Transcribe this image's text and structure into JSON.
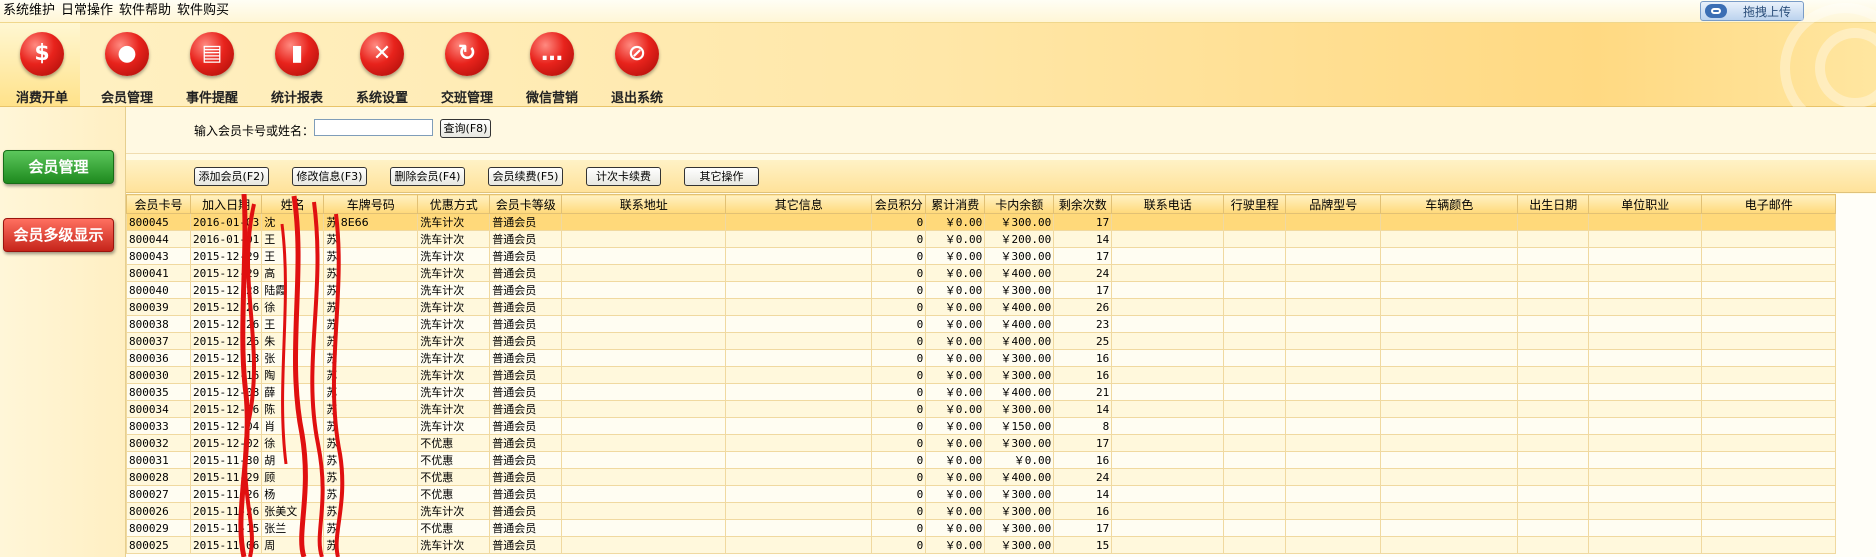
{
  "menu": [
    "系统维护",
    "日常操作",
    "软件帮助",
    "软件购买"
  ],
  "upload_button": "拖拽上传",
  "toolbar": [
    {
      "label": "消费开单",
      "icon": "dollar-icon",
      "glyph": "$"
    },
    {
      "label": "会员管理",
      "icon": "member-icon",
      "glyph": "●"
    },
    {
      "label": "事件提醒",
      "icon": "book-icon",
      "glyph": "▤"
    },
    {
      "label": "统计报表",
      "icon": "bar-chart-icon",
      "glyph": "▮"
    },
    {
      "label": "系统设置",
      "icon": "tools-icon",
      "glyph": "✕"
    },
    {
      "label": "交班管理",
      "icon": "refresh-icon",
      "glyph": "↻"
    },
    {
      "label": "微信营销",
      "icon": "chat-icon",
      "glyph": "…"
    },
    {
      "label": "退出系统",
      "icon": "no-entry-icon",
      "glyph": "⊘"
    }
  ],
  "sidebar": {
    "member_manage": "会员管理",
    "member_level_display": "会员多级显示"
  },
  "search": {
    "label": "输入会员卡号或姓名：",
    "value": "",
    "query_button": "查询(F8)"
  },
  "actions": {
    "add": "添加会员(F2)",
    "edit": "修改信息(F3)",
    "delete": "删除会员(F4)",
    "renew": "会员续费(F5)",
    "count_renew": "计次卡续费",
    "other": "其它操作"
  },
  "table": {
    "columns": [
      "会员卡号",
      "加入日期",
      "姓名",
      "车牌号码",
      "优惠方式",
      "会员卡等级",
      "联系地址",
      "其它信息",
      "会员积分",
      "累计消费",
      "卡内余额",
      "剩余次数",
      "联系电话",
      "行驶里程",
      "品牌型号",
      "车辆颜色",
      "出生日期",
      "单位职业",
      "电子邮件"
    ],
    "rows": [
      [
        "800045",
        "2016-01-03",
        "沈",
        "苏 8E66",
        "洗车计次",
        "普通会员",
        "",
        "",
        "0",
        "￥0.00",
        "￥300.00",
        "17"
      ],
      [
        "800044",
        "2016-01-01",
        "王",
        "苏",
        "洗车计次",
        "普通会员",
        "",
        "",
        "0",
        "￥0.00",
        "￥200.00",
        "14"
      ],
      [
        "800043",
        "2015-12-29",
        "王",
        "苏",
        "洗车计次",
        "普通会员",
        "",
        "",
        "0",
        "￥0.00",
        "￥300.00",
        "17"
      ],
      [
        "800041",
        "2015-12-29",
        "高",
        "苏",
        "洗车计次",
        "普通会员",
        "",
        "",
        "0",
        "￥0.00",
        "￥400.00",
        "24"
      ],
      [
        "800040",
        "2015-12-28",
        "陆霞",
        "苏",
        "洗车计次",
        "普通会员",
        "",
        "",
        "0",
        "￥0.00",
        "￥300.00",
        "17"
      ],
      [
        "800039",
        "2015-12-26",
        "徐",
        "苏",
        "洗车计次",
        "普通会员",
        "",
        "",
        "0",
        "￥0.00",
        "￥400.00",
        "26"
      ],
      [
        "800038",
        "2015-12-26",
        "王",
        "苏",
        "洗车计次",
        "普通会员",
        "",
        "",
        "0",
        "￥0.00",
        "￥400.00",
        "23"
      ],
      [
        "800037",
        "2015-12-26",
        "朱",
        "苏",
        "洗车计次",
        "普通会员",
        "",
        "",
        "0",
        "￥0.00",
        "￥400.00",
        "25"
      ],
      [
        "800036",
        "2015-12-18",
        "张",
        "苏",
        "洗车计次",
        "普通会员",
        "",
        "",
        "0",
        "￥0.00",
        "￥300.00",
        "16"
      ],
      [
        "800030",
        "2015-12-16",
        "陶",
        "苏",
        "洗车计次",
        "普通会员",
        "",
        "",
        "0",
        "￥0.00",
        "￥300.00",
        "16"
      ],
      [
        "800035",
        "2015-12-08",
        "薛",
        "苏",
        "洗车计次",
        "普通会员",
        "",
        "",
        "0",
        "￥0.00",
        "￥400.00",
        "21"
      ],
      [
        "800034",
        "2015-12-06",
        "陈",
        "苏",
        "洗车计次",
        "普通会员",
        "",
        "",
        "0",
        "￥0.00",
        "￥300.00",
        "14"
      ],
      [
        "800033",
        "2015-12-04",
        "肖",
        "苏",
        "洗车计次",
        "普通会员",
        "",
        "",
        "0",
        "￥0.00",
        "￥150.00",
        "8"
      ],
      [
        "800032",
        "2015-12-02",
        "徐",
        "苏",
        "不优惠",
        "普通会员",
        "",
        "",
        "0",
        "￥0.00",
        "￥300.00",
        "17"
      ],
      [
        "800031",
        "2015-11-30",
        "胡",
        "苏",
        "不优惠",
        "普通会员",
        "",
        "",
        "0",
        "￥0.00",
        "￥0.00",
        "16"
      ],
      [
        "800028",
        "2015-11-29",
        "顾",
        "苏",
        "不优惠",
        "普通会员",
        "",
        "",
        "0",
        "￥0.00",
        "￥400.00",
        "24"
      ],
      [
        "800027",
        "2015-11-26",
        "杨",
        "苏",
        "不优惠",
        "普通会员",
        "",
        "",
        "0",
        "￥0.00",
        "￥300.00",
        "14"
      ],
      [
        "800026",
        "2015-11-26",
        "张美文",
        "苏",
        "洗车计次",
        "普通会员",
        "",
        "",
        "0",
        "￥0.00",
        "￥300.00",
        "16"
      ],
      [
        "800029",
        "2015-11-15",
        "张兰",
        "苏",
        "不优惠",
        "普通会员",
        "",
        "",
        "0",
        "￥0.00",
        "￥300.00",
        "17"
      ],
      [
        "800025",
        "2015-11-06",
        "周",
        "苏",
        "洗车计次",
        "普通会员",
        "",
        "",
        "0",
        "￥0.00",
        "￥300.00",
        "15"
      ]
    ]
  }
}
